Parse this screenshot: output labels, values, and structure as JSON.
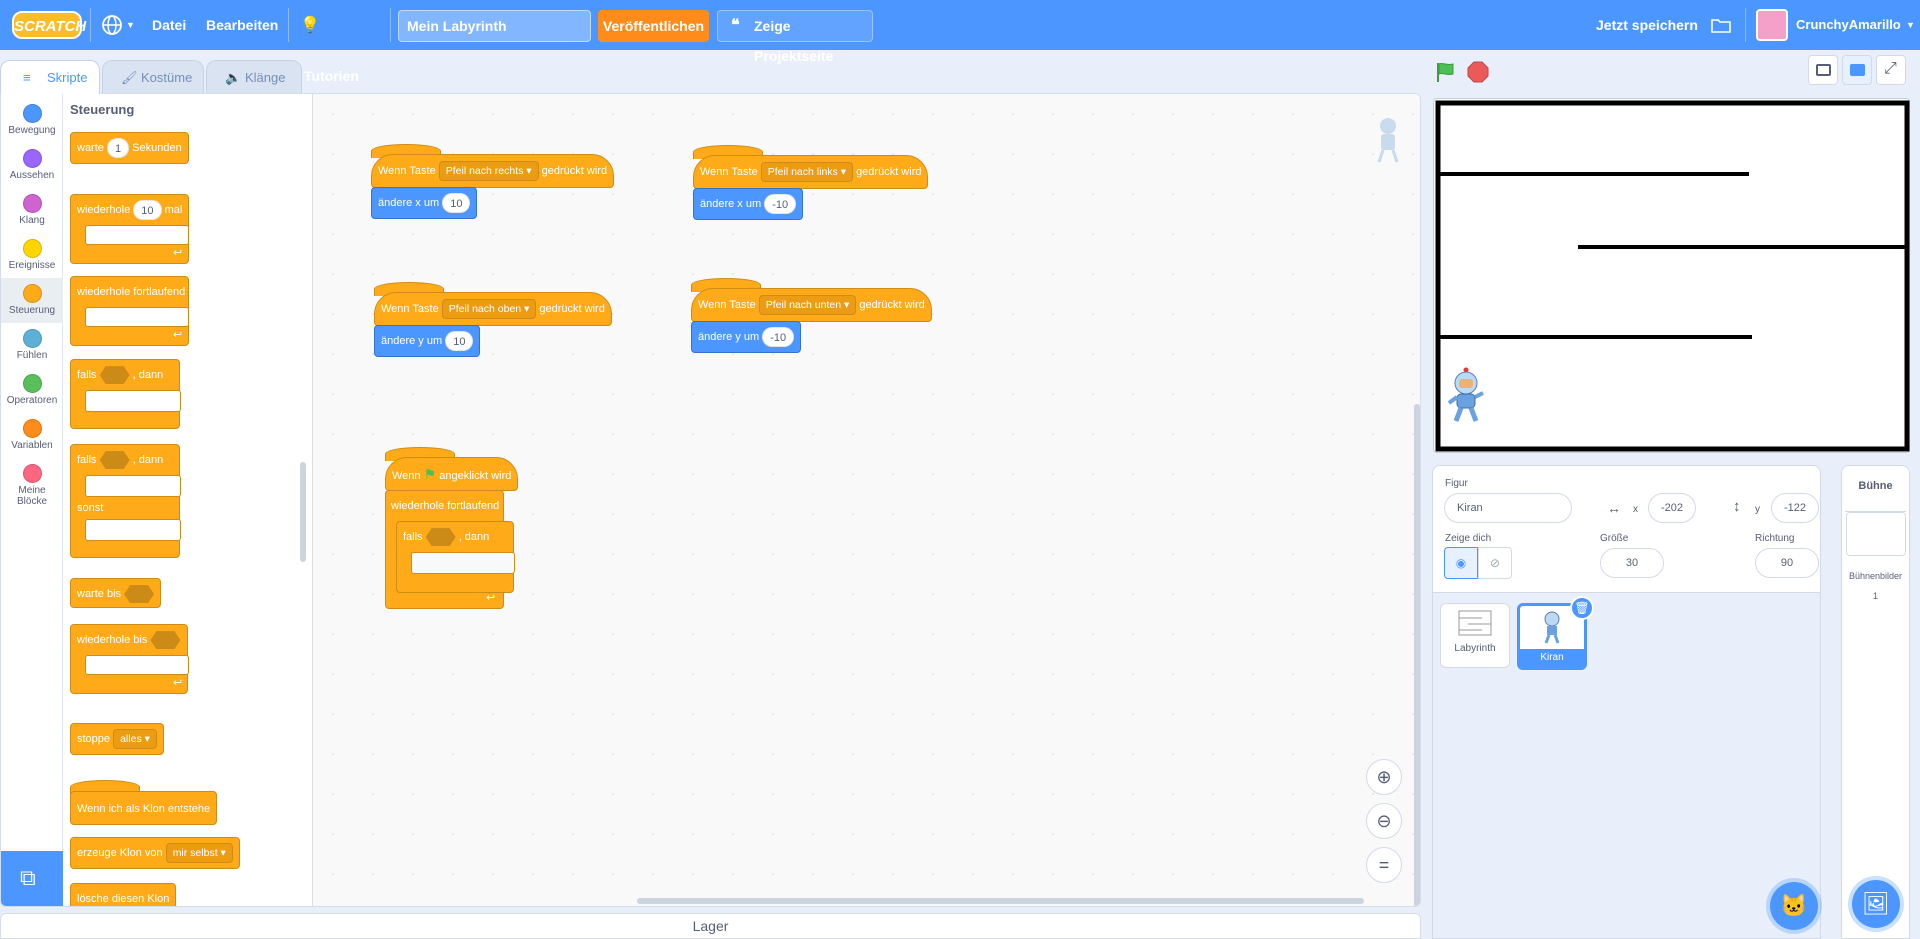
{
  "menubar": {
    "logo": "SCRATCH",
    "file": "Datei",
    "edit": "Bearbeiten",
    "tutorials": "Tutorien",
    "project_title": "Mein Labyrinth",
    "publish": "Veröffentlichen",
    "project_page": "Zeige Projektseite",
    "save_now": "Jetzt speichern",
    "username": "CrunchyAmarillo"
  },
  "tabs": {
    "code": "Skripte",
    "costumes": "Kostüme",
    "sounds": "Klänge"
  },
  "categories": [
    {
      "label": "Bewegung",
      "color": "#4c97ff"
    },
    {
      "label": "Aussehen",
      "color": "#9966ff"
    },
    {
      "label": "Klang",
      "color": "#cf63cf"
    },
    {
      "label": "Ereignisse",
      "color": "#ffd500"
    },
    {
      "label": "Steuerung",
      "color": "#ffab19"
    },
    {
      "label": "Fühlen",
      "color": "#5cb1d6"
    },
    {
      "label": "Operatoren",
      "color": "#59c059"
    },
    {
      "label": "Variablen",
      "color": "#ff8c1a"
    },
    {
      "label": "Meine Blöcke",
      "color": "#ff6680"
    }
  ],
  "palette": {
    "heading": "Steuerung",
    "wait": "warte",
    "wait_value": "1",
    "seconds": "Sekunden",
    "repeat": "wiederhole",
    "repeat_value": "10",
    "times": "mal",
    "forever": "wiederhole fortlaufend",
    "if": "falls",
    "then": ", dann",
    "else": "sonst",
    "wait_until": "warte bis",
    "repeat_until": "wiederhole bis",
    "stop": "stoppe",
    "stop_option": "alles",
    "when_clone": "Wenn ich als Klon entstehe",
    "create_clone": "erzeuge Klon von",
    "clone_option": "mir selbst",
    "delete_clone": "lösche diesen Klon"
  },
  "scripts": {
    "when_key": "Wenn Taste",
    "pressed": "gedrückt wird",
    "right": "Pfeil nach rechts",
    "left": "Pfeil nach links",
    "up": "Pfeil nach oben",
    "down": "Pfeil nach unten",
    "change_x": "ändere x um",
    "change_y": "ändere y um",
    "v_plus": "10",
    "v_minus": "-10",
    "when": "Wenn",
    "flag_clicked": "angeklickt wird",
    "forever": "wiederhole fortlaufend",
    "if": "falls",
    "then": ", dann"
  },
  "sprite": {
    "label": "Figur",
    "name": "Kiran",
    "x_label": "x",
    "x": "-202",
    "y_label": "y",
    "y": "-122",
    "show_label": "Zeige dich",
    "size_label": "Größe",
    "size": "30",
    "direction_label": "Richtung",
    "direction": "90"
  },
  "sprites": [
    {
      "name": "Labyrinth"
    },
    {
      "name": "Kiran"
    }
  ],
  "stage_panel": {
    "title": "Bühne",
    "backdrops_label": "Bühnenbilder",
    "backdrops_count": "1"
  },
  "backpack": "Lager",
  "colors": {
    "menu": "#4c97ff",
    "control": "#ffab19",
    "motion": "#4c97ff",
    "publish": "#ff8c1a"
  }
}
